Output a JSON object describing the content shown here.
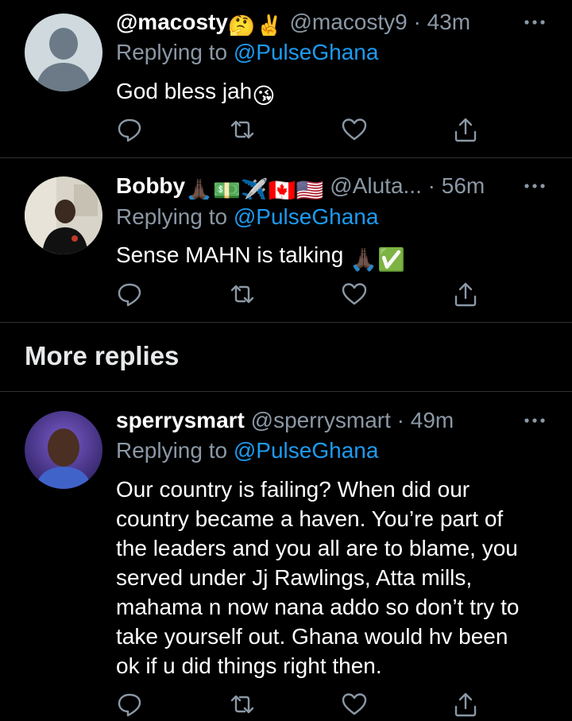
{
  "tweets": [
    {
      "display_name": "@macosty",
      "name_emojis": [
        "🤔",
        "✌️"
      ],
      "handle": "@macosty9",
      "separator": "·",
      "time": "43m",
      "replying_label": "Replying to",
      "replying_to": "@PulseGhana",
      "body": [
        "God bless jah"
      ],
      "body_emoji": "😘"
    },
    {
      "display_name": "Bobby",
      "name_emojis": [
        "🙏🏿",
        "💵",
        "✈️",
        "🇨🇦",
        "🇺🇸"
      ],
      "handle": "@Aluta...",
      "separator": "·",
      "time": "56m",
      "replying_label": "Replying to",
      "replying_to": "@PulseGhana",
      "body": [
        "Sense MAHN is talking"
      ],
      "body_emoji": "🙏🏿✅"
    },
    {
      "display_name": "sperrysmart",
      "handle": "@sperrysmart",
      "separator": "·",
      "time": "49m",
      "replying_label": "Replying to",
      "replying_to": "@PulseGhana",
      "body": [
        "Our country is failing? When did our",
        "country became a haven. You’re part of",
        "the leaders and you all are to blame, you",
        "served under Jj Rawlings, Atta mills,",
        "mahama n now nana addo so don’t try to",
        "take yourself out. Ghana would hv been",
        "ok if u did things right then."
      ]
    }
  ],
  "section": {
    "more_replies": "More replies"
  },
  "icons": {
    "reply": "reply-icon",
    "retweet": "retweet-icon",
    "like": "heart-icon",
    "share": "share-icon",
    "more": "more-dots-icon"
  },
  "colors": {
    "background": "#000000",
    "text": "#ffffff",
    "muted": "#8b98a5",
    "link": "#1d9bf0",
    "divider": "#2f3336"
  }
}
